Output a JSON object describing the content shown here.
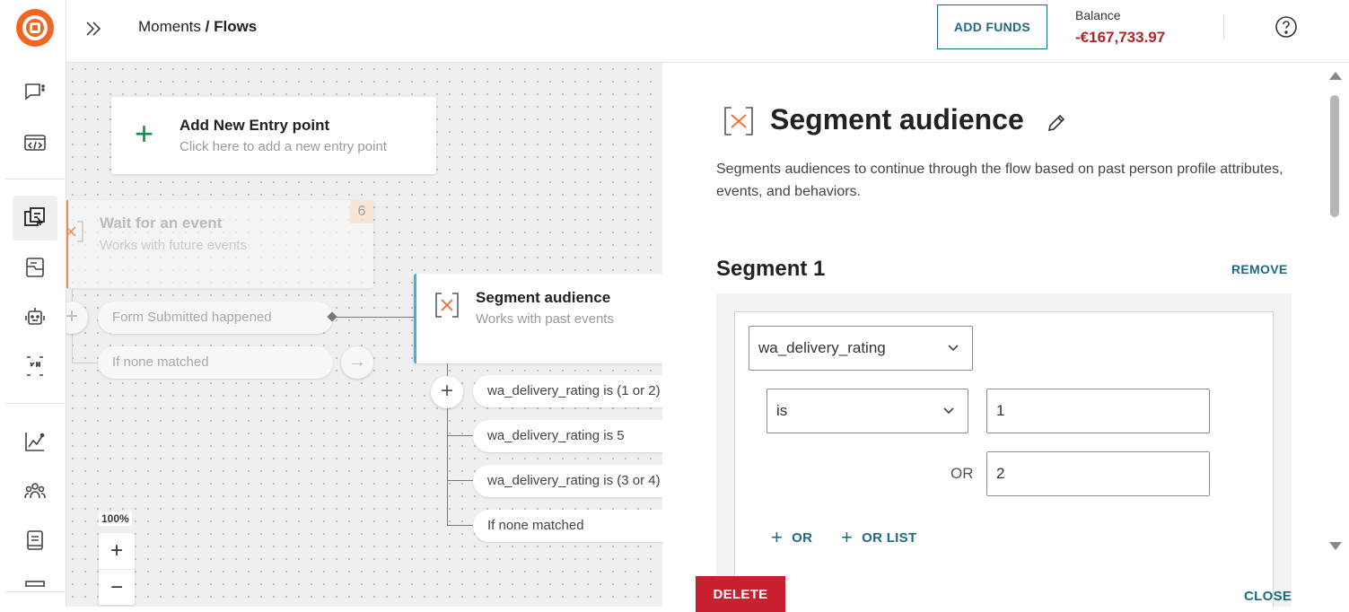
{
  "header": {
    "breadcrumb_parent": "Moments",
    "breadcrumb_sep": " / ",
    "breadcrumb_current": "Flows",
    "add_funds_label": "ADD FUNDS",
    "balance_label": "Balance",
    "balance_value": "-€167,733.97"
  },
  "canvas": {
    "entry_title": "Add New Entry point",
    "entry_subtitle": "Click here to add a new entry point",
    "wait_title": "Wait for an event",
    "wait_subtitle": "Works with future events",
    "wait_badge": "6",
    "wait_branches": [
      "Form Submitted happened",
      "If none matched"
    ],
    "segment_title": "Segment audience",
    "segment_subtitle": "Works with past events",
    "segment_branches": [
      "wa_delivery_rating is (1 or 2)",
      "wa_delivery_rating is 5",
      "wa_delivery_rating is (3 or 4)",
      "If none matched"
    ],
    "zoom_level": "100%"
  },
  "panel": {
    "title": "Segment audience",
    "description": "Segments audiences to continue through the flow based on past person profile attributes, events, and behaviors.",
    "segment_heading": "Segment 1",
    "remove_label": "REMOVE",
    "attribute_value": "wa_delivery_rating",
    "operator_value": "is",
    "value_1": "1",
    "or_label": "OR",
    "value_2": "2",
    "add_or_label": "OR",
    "add_or_list_label": "OR LIST",
    "delete_label": "DELETE",
    "close_label": "CLOSE"
  },
  "colors": {
    "brand": "#f26522",
    "accent": "#1e6a82",
    "balance": "#b2232a",
    "danger": "#c9202f",
    "selected_node": "#3fb3d7"
  }
}
